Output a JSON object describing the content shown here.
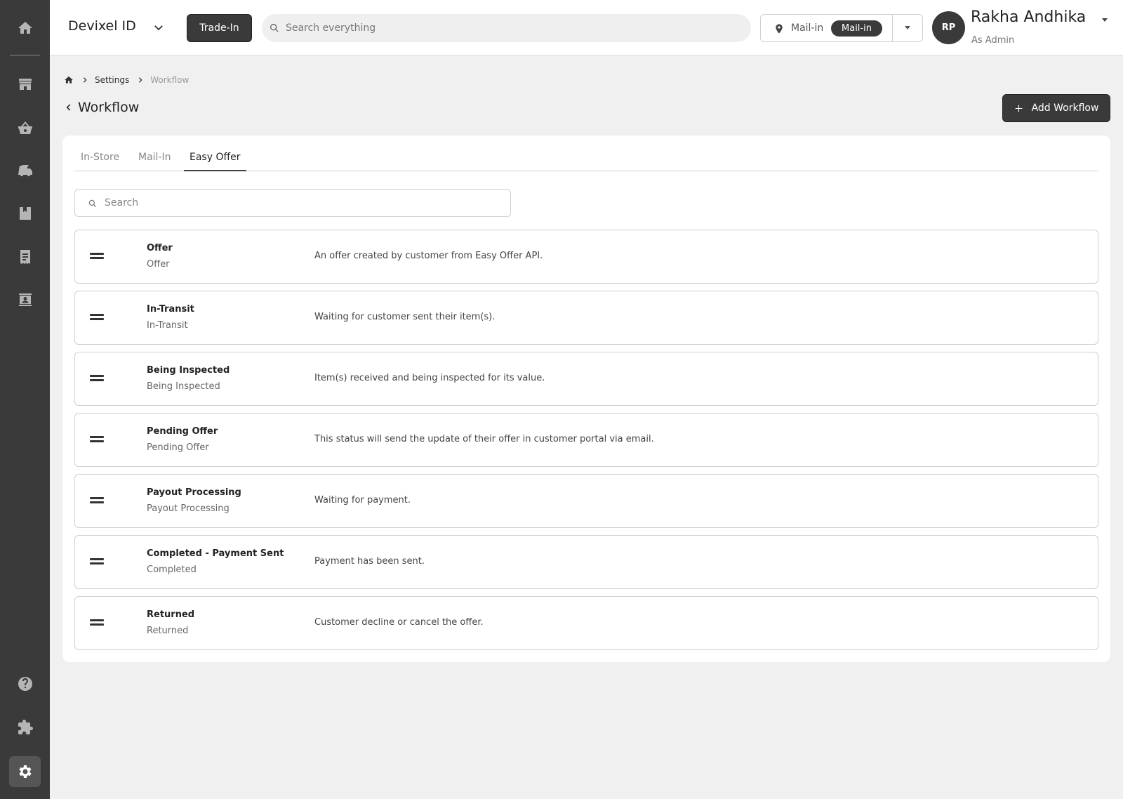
{
  "topbar": {
    "brand": "Devixel ID",
    "trade_in_label": "Trade-In",
    "search_placeholder": "Search everything",
    "location_label": "Mail-in",
    "location_value": "Mail-in",
    "user": {
      "initials": "RP",
      "name": "Rakha Andhika",
      "role": "As Admin"
    }
  },
  "sidebar": {
    "items": [
      {
        "icon": "home-icon"
      },
      {
        "icon": "store-icon"
      },
      {
        "icon": "basket-icon"
      },
      {
        "icon": "truck-icon"
      },
      {
        "icon": "book-icon"
      },
      {
        "icon": "receipt-icon"
      },
      {
        "icon": "contact-icon"
      },
      {
        "icon": "help-icon"
      },
      {
        "icon": "puzzle-icon"
      },
      {
        "icon": "gear-icon",
        "active": true
      }
    ]
  },
  "breadcrumb": {
    "items": [
      "Settings",
      "Workflow"
    ]
  },
  "page": {
    "title": "Workflow",
    "add_button_label": "Add Workflow"
  },
  "tabs": [
    {
      "label": "In-Store",
      "active": false
    },
    {
      "label": "Mail-In",
      "active": false
    },
    {
      "label": "Easy Offer",
      "active": true
    }
  ],
  "search": {
    "placeholder": "Search"
  },
  "workflows": [
    {
      "name": "Offer",
      "code": "Offer",
      "description": "An offer created by customer from Easy Offer API."
    },
    {
      "name": "In-Transit",
      "code": "In-Transit",
      "description": "Waiting for customer sent their item(s)."
    },
    {
      "name": "Being Inspected",
      "code": "Being Inspected",
      "description": "Item(s) received and being inspected for its value."
    },
    {
      "name": "Pending Offer",
      "code": "Pending Offer",
      "description": "This status will send the update of their offer in customer portal via email."
    },
    {
      "name": "Payout Processing",
      "code": "Payout Processing",
      "description": "Waiting for payment."
    },
    {
      "name": "Completed - Payment Sent",
      "code": "Completed",
      "description": "Payment has been sent."
    },
    {
      "name": "Returned",
      "code": "Returned",
      "description": "Customer decline or cancel the offer."
    }
  ]
}
